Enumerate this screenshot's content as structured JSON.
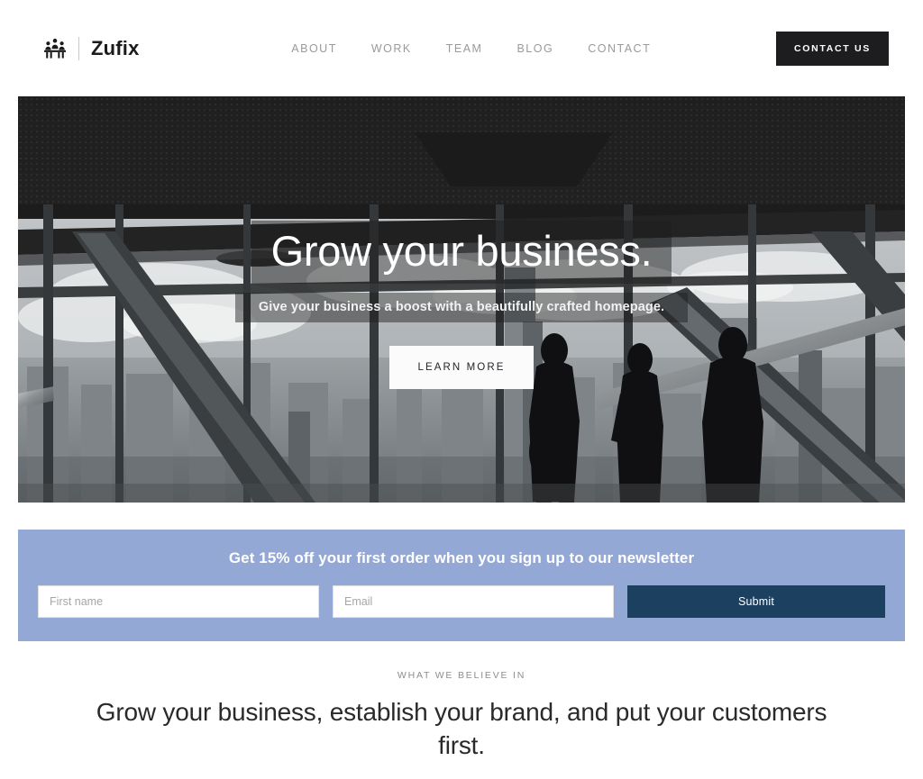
{
  "header": {
    "logo_icon": "people-meeting-icon",
    "brand_name": "Zufix",
    "nav": [
      {
        "label": "ABOUT"
      },
      {
        "label": "WORK"
      },
      {
        "label": "TEAM"
      },
      {
        "label": "BLOG"
      },
      {
        "label": "CONTACT"
      }
    ],
    "cta_label": "CONTACT US",
    "cta_bg": "#1d1d1f"
  },
  "hero": {
    "title": "Grow your business.",
    "subtitle": "Give your business a boost with a beautifully crafted homepage.",
    "button_label": "LEARN MORE",
    "image_description": "Black and white photo of people standing by floor-to-ceiling windows of a high-rise office overlooking a city skyline"
  },
  "newsletter": {
    "title": "Get 15% off your first order when you sign up to our newsletter",
    "background": "#94a8d6",
    "first_name_placeholder": "First name",
    "first_name_value": "",
    "email_placeholder": "Email",
    "email_value": "",
    "submit_label": "Submit",
    "submit_bg": "#1b4060"
  },
  "believe": {
    "eyebrow": "WHAT WE BELIEVE IN",
    "heading": "Grow your business, establish your brand, and put your customers first."
  }
}
